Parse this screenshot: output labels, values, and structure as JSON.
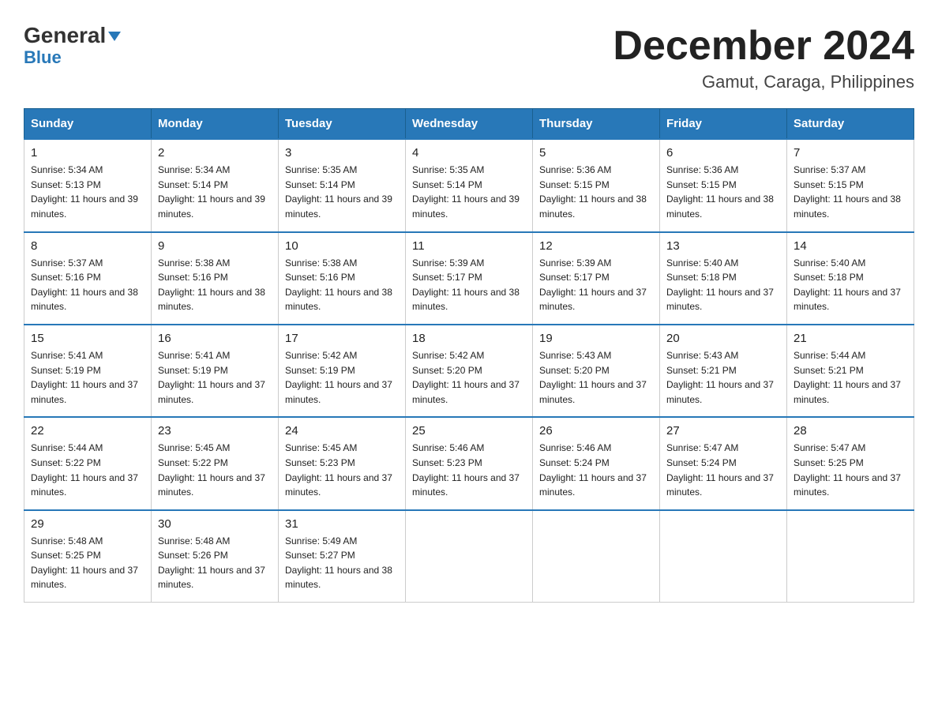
{
  "header": {
    "logo_general": "General",
    "logo_blue": "Blue",
    "month_title": "December 2024",
    "location": "Gamut, Caraga, Philippines"
  },
  "days_of_week": [
    "Sunday",
    "Monday",
    "Tuesday",
    "Wednesday",
    "Thursday",
    "Friday",
    "Saturday"
  ],
  "weeks": [
    [
      {
        "day": "1",
        "sunrise": "5:34 AM",
        "sunset": "5:13 PM",
        "daylight": "11 hours and 39 minutes."
      },
      {
        "day": "2",
        "sunrise": "5:34 AM",
        "sunset": "5:14 PM",
        "daylight": "11 hours and 39 minutes."
      },
      {
        "day": "3",
        "sunrise": "5:35 AM",
        "sunset": "5:14 PM",
        "daylight": "11 hours and 39 minutes."
      },
      {
        "day": "4",
        "sunrise": "5:35 AM",
        "sunset": "5:14 PM",
        "daylight": "11 hours and 39 minutes."
      },
      {
        "day": "5",
        "sunrise": "5:36 AM",
        "sunset": "5:15 PM",
        "daylight": "11 hours and 38 minutes."
      },
      {
        "day": "6",
        "sunrise": "5:36 AM",
        "sunset": "5:15 PM",
        "daylight": "11 hours and 38 minutes."
      },
      {
        "day": "7",
        "sunrise": "5:37 AM",
        "sunset": "5:15 PM",
        "daylight": "11 hours and 38 minutes."
      }
    ],
    [
      {
        "day": "8",
        "sunrise": "5:37 AM",
        "sunset": "5:16 PM",
        "daylight": "11 hours and 38 minutes."
      },
      {
        "day": "9",
        "sunrise": "5:38 AM",
        "sunset": "5:16 PM",
        "daylight": "11 hours and 38 minutes."
      },
      {
        "day": "10",
        "sunrise": "5:38 AM",
        "sunset": "5:16 PM",
        "daylight": "11 hours and 38 minutes."
      },
      {
        "day": "11",
        "sunrise": "5:39 AM",
        "sunset": "5:17 PM",
        "daylight": "11 hours and 38 minutes."
      },
      {
        "day": "12",
        "sunrise": "5:39 AM",
        "sunset": "5:17 PM",
        "daylight": "11 hours and 37 minutes."
      },
      {
        "day": "13",
        "sunrise": "5:40 AM",
        "sunset": "5:18 PM",
        "daylight": "11 hours and 37 minutes."
      },
      {
        "day": "14",
        "sunrise": "5:40 AM",
        "sunset": "5:18 PM",
        "daylight": "11 hours and 37 minutes."
      }
    ],
    [
      {
        "day": "15",
        "sunrise": "5:41 AM",
        "sunset": "5:19 PM",
        "daylight": "11 hours and 37 minutes."
      },
      {
        "day": "16",
        "sunrise": "5:41 AM",
        "sunset": "5:19 PM",
        "daylight": "11 hours and 37 minutes."
      },
      {
        "day": "17",
        "sunrise": "5:42 AM",
        "sunset": "5:19 PM",
        "daylight": "11 hours and 37 minutes."
      },
      {
        "day": "18",
        "sunrise": "5:42 AM",
        "sunset": "5:20 PM",
        "daylight": "11 hours and 37 minutes."
      },
      {
        "day": "19",
        "sunrise": "5:43 AM",
        "sunset": "5:20 PM",
        "daylight": "11 hours and 37 minutes."
      },
      {
        "day": "20",
        "sunrise": "5:43 AM",
        "sunset": "5:21 PM",
        "daylight": "11 hours and 37 minutes."
      },
      {
        "day": "21",
        "sunrise": "5:44 AM",
        "sunset": "5:21 PM",
        "daylight": "11 hours and 37 minutes."
      }
    ],
    [
      {
        "day": "22",
        "sunrise": "5:44 AM",
        "sunset": "5:22 PM",
        "daylight": "11 hours and 37 minutes."
      },
      {
        "day": "23",
        "sunrise": "5:45 AM",
        "sunset": "5:22 PM",
        "daylight": "11 hours and 37 minutes."
      },
      {
        "day": "24",
        "sunrise": "5:45 AM",
        "sunset": "5:23 PM",
        "daylight": "11 hours and 37 minutes."
      },
      {
        "day": "25",
        "sunrise": "5:46 AM",
        "sunset": "5:23 PM",
        "daylight": "11 hours and 37 minutes."
      },
      {
        "day": "26",
        "sunrise": "5:46 AM",
        "sunset": "5:24 PM",
        "daylight": "11 hours and 37 minutes."
      },
      {
        "day": "27",
        "sunrise": "5:47 AM",
        "sunset": "5:24 PM",
        "daylight": "11 hours and 37 minutes."
      },
      {
        "day": "28",
        "sunrise": "5:47 AM",
        "sunset": "5:25 PM",
        "daylight": "11 hours and 37 minutes."
      }
    ],
    [
      {
        "day": "29",
        "sunrise": "5:48 AM",
        "sunset": "5:25 PM",
        "daylight": "11 hours and 37 minutes."
      },
      {
        "day": "30",
        "sunrise": "5:48 AM",
        "sunset": "5:26 PM",
        "daylight": "11 hours and 37 minutes."
      },
      {
        "day": "31",
        "sunrise": "5:49 AM",
        "sunset": "5:27 PM",
        "daylight": "11 hours and 38 minutes."
      },
      null,
      null,
      null,
      null
    ]
  ]
}
